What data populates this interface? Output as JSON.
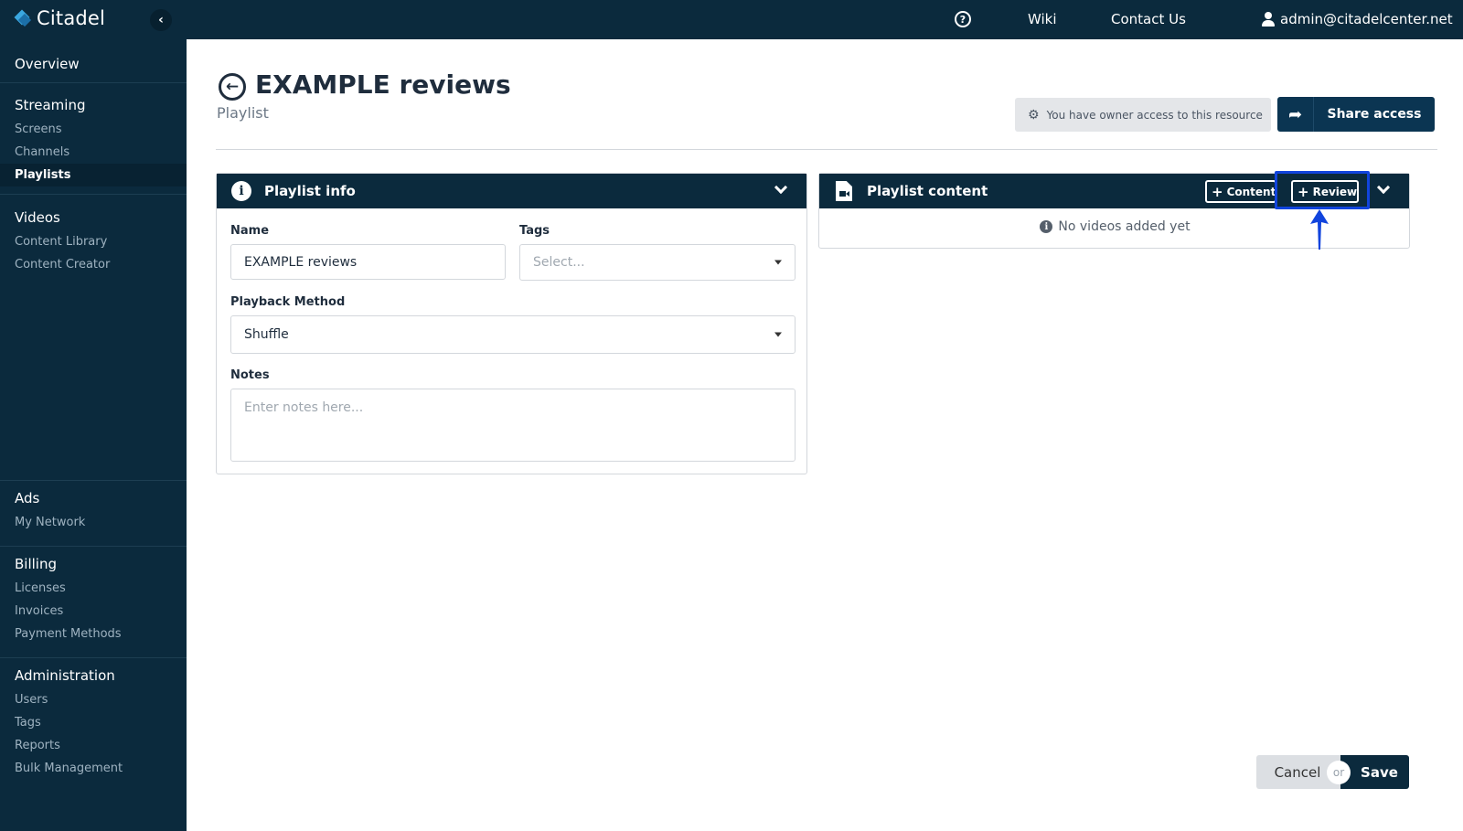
{
  "app": {
    "name": "Citadel"
  },
  "topbar": {
    "links": {
      "wiki": "Wiki",
      "contact": "Contact Us"
    },
    "user": "admin@citadelcenter.net",
    "help_icon": "question-circle-icon"
  },
  "sidebar": {
    "overview": "Overview",
    "sections": {
      "streaming": {
        "title": "Streaming",
        "items": [
          "Screens",
          "Channels",
          "Playlists"
        ]
      },
      "videos": {
        "title": "Videos",
        "items": [
          "Content Library",
          "Content Creator"
        ]
      },
      "ads": {
        "title": "Ads",
        "items": [
          "My Network"
        ]
      },
      "billing": {
        "title": "Billing",
        "items": [
          "Licenses",
          "Invoices",
          "Payment Methods"
        ]
      },
      "administration": {
        "title": "Administration",
        "items": [
          "Users",
          "Tags",
          "Reports",
          "Bulk Management"
        ]
      }
    },
    "active_item": "Playlists"
  },
  "page": {
    "title": "EXAMPLE reviews",
    "subtitle": "Playlist",
    "owner_access": "You have owner access to this resource",
    "share_label": "Share access"
  },
  "playlist_info": {
    "title": "Playlist info",
    "name_label": "Name",
    "name_value": "EXAMPLE reviews",
    "tags_label": "Tags",
    "tags_placeholder": "Select...",
    "playback_label": "Playback Method",
    "playback_value": "Shuffle",
    "notes_label": "Notes",
    "notes_placeholder": "Enter notes here..."
  },
  "playlist_content": {
    "title": "Playlist content",
    "content_btn": "Content",
    "review_btn": "Review",
    "empty_msg": "No videos added yet"
  },
  "footer": {
    "cancel": "Cancel",
    "or": "or",
    "save": "Save"
  },
  "colors": {
    "navy": "#0b2a3d",
    "highlight": "#1144dd"
  }
}
